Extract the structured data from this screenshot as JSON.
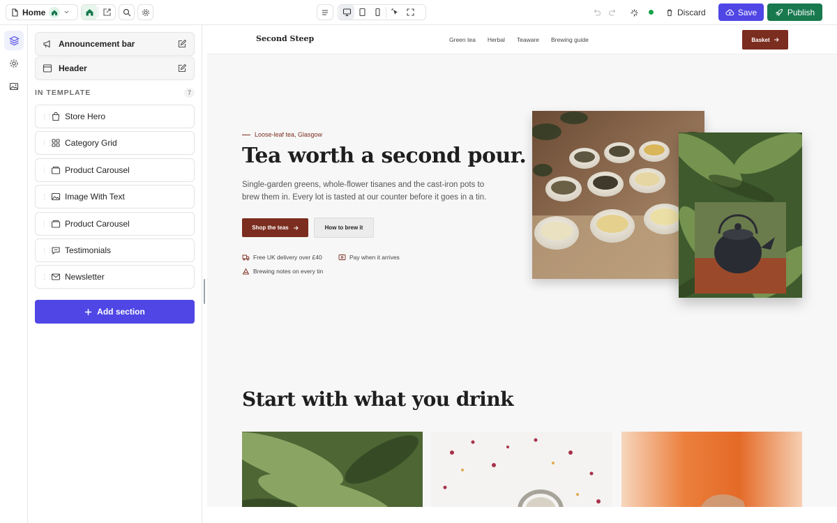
{
  "toolbar": {
    "page_name": "Home",
    "discard_label": "Discard",
    "save_label": "Save",
    "publish_label": "Publish"
  },
  "panel": {
    "fixed_sections": [
      "Announcement bar",
      "Header"
    ],
    "heading": "IN TEMPLATE",
    "count": "7",
    "sections": [
      {
        "label": "Store Hero",
        "icon": "bag-icon"
      },
      {
        "label": "Category Grid",
        "icon": "grid-icon"
      },
      {
        "label": "Product Carousel",
        "icon": "carousel-icon"
      },
      {
        "label": "Image With Text",
        "icon": "image-icon"
      },
      {
        "label": "Product Carousel",
        "icon": "carousel-icon"
      },
      {
        "label": "Testimonials",
        "icon": "chat-icon"
      },
      {
        "label": "Newsletter",
        "icon": "mail-icon"
      }
    ],
    "add_section_label": "Add section"
  },
  "site": {
    "logo": "Second Steep",
    "nav": [
      "Green tea",
      "Herbal",
      "Teaware",
      "Brewing guide"
    ],
    "basket_label": "Basket",
    "hero": {
      "eyebrow": "Loose-leaf tea, Glasgow",
      "title": "Tea worth a second pour.",
      "body": "Single-garden greens, whole-flower tisanes and the cast-iron pots to brew them in. Every lot is tasted at our counter before it goes in a tin.",
      "cta_primary": "Shop the teas",
      "cta_secondary": "How to brew it",
      "perks": [
        "Free UK delivery over £40",
        "Pay when it arrives",
        "Brewing notes on every tin"
      ]
    },
    "categories_title": "Start with what you drink"
  },
  "colors": {
    "accent_indigo": "#4f46e5",
    "publish_green": "#18794e",
    "brand_brown": "#7b2d1f"
  }
}
